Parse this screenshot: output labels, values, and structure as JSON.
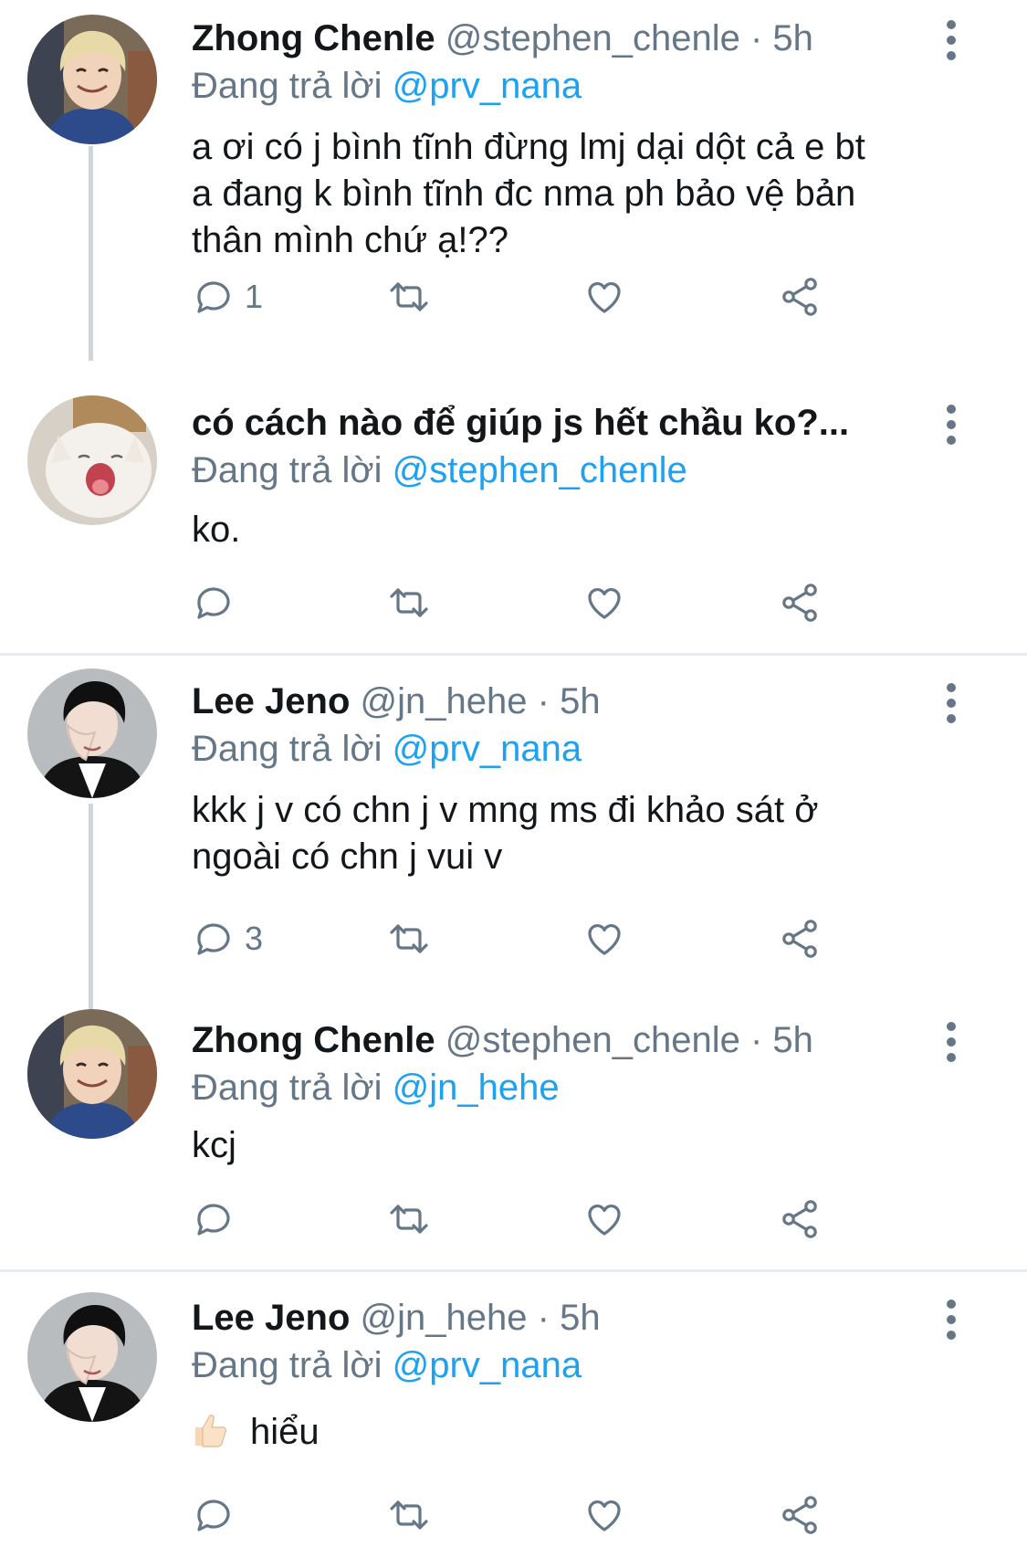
{
  "tweets": [
    {
      "name": "Zhong Chenle",
      "handle": "@stephen_chenle",
      "dot": "·",
      "time": "5h",
      "reply_prefix": "Đang trả lời",
      "reply_to": "@prv_nana",
      "lines": [
        "a ơi có j bình tĩnh đừng lmj dại dột cả e bt",
        "a đang k bình tĩnh đc nma ph bảo vệ bản",
        "thân mình chứ ạ!??"
      ],
      "reply_count": "1",
      "avatar_icon": "avatar-blond-person"
    },
    {
      "name": "có cách nào để giúp js hết chầu ko?...",
      "reply_prefix": "Đang trả lời",
      "reply_to": "@stephen_chenle",
      "lines": [
        "ko."
      ],
      "reply_count": "",
      "avatar_icon": "avatar-white-cat"
    },
    {
      "name": "Lee Jeno",
      "handle": "@jn_hehe",
      "dot": "·",
      "time": "5h",
      "reply_prefix": "Đang trả lời",
      "reply_to": "@prv_nana",
      "lines": [
        "kkk j v có chn j v mng ms đi khảo sát ở",
        "ngoài có chn j vui v"
      ],
      "reply_count": "3",
      "avatar_icon": "avatar-dark-hair-person"
    },
    {
      "name": "Zhong Chenle",
      "handle": "@stephen_chenle",
      "dot": "·",
      "time": "5h",
      "reply_prefix": "Đang trả lời",
      "reply_to": "@jn_hehe",
      "lines": [
        "kcj"
      ],
      "reply_count": "",
      "avatar_icon": "avatar-blond-person"
    },
    {
      "name": "Lee Jeno",
      "handle": "@jn_hehe",
      "dot": "·",
      "time": "5h",
      "reply_prefix": "Đang trả lời",
      "reply_to": "@prv_nana",
      "lines": [
        "hiểu"
      ],
      "emoji": "thumbs-up-icon",
      "reply_count": "",
      "avatar_icon": "avatar-dark-hair-person"
    }
  ],
  "colors": {
    "text": "#14171a",
    "secondary": "#657786",
    "link": "#1da1f2",
    "thread_line": "#ccd6dd",
    "divider": "#e6ecf0"
  }
}
